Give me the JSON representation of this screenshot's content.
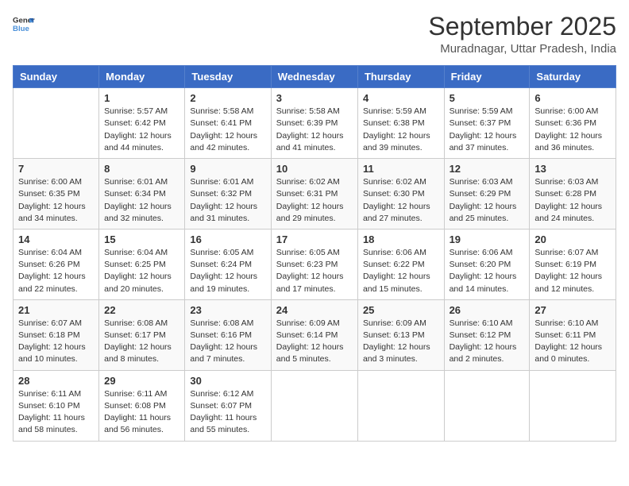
{
  "header": {
    "logo_general": "General",
    "logo_blue": "Blue",
    "month_year": "September 2025",
    "location": "Muradnagar, Uttar Pradesh, India"
  },
  "weekdays": [
    "Sunday",
    "Monday",
    "Tuesday",
    "Wednesday",
    "Thursday",
    "Friday",
    "Saturday"
  ],
  "weeks": [
    [
      {
        "day": "",
        "info": ""
      },
      {
        "day": "1",
        "info": "Sunrise: 5:57 AM\nSunset: 6:42 PM\nDaylight: 12 hours\nand 44 minutes."
      },
      {
        "day": "2",
        "info": "Sunrise: 5:58 AM\nSunset: 6:41 PM\nDaylight: 12 hours\nand 42 minutes."
      },
      {
        "day": "3",
        "info": "Sunrise: 5:58 AM\nSunset: 6:39 PM\nDaylight: 12 hours\nand 41 minutes."
      },
      {
        "day": "4",
        "info": "Sunrise: 5:59 AM\nSunset: 6:38 PM\nDaylight: 12 hours\nand 39 minutes."
      },
      {
        "day": "5",
        "info": "Sunrise: 5:59 AM\nSunset: 6:37 PM\nDaylight: 12 hours\nand 37 minutes."
      },
      {
        "day": "6",
        "info": "Sunrise: 6:00 AM\nSunset: 6:36 PM\nDaylight: 12 hours\nand 36 minutes."
      }
    ],
    [
      {
        "day": "7",
        "info": "Sunrise: 6:00 AM\nSunset: 6:35 PM\nDaylight: 12 hours\nand 34 minutes."
      },
      {
        "day": "8",
        "info": "Sunrise: 6:01 AM\nSunset: 6:34 PM\nDaylight: 12 hours\nand 32 minutes."
      },
      {
        "day": "9",
        "info": "Sunrise: 6:01 AM\nSunset: 6:32 PM\nDaylight: 12 hours\nand 31 minutes."
      },
      {
        "day": "10",
        "info": "Sunrise: 6:02 AM\nSunset: 6:31 PM\nDaylight: 12 hours\nand 29 minutes."
      },
      {
        "day": "11",
        "info": "Sunrise: 6:02 AM\nSunset: 6:30 PM\nDaylight: 12 hours\nand 27 minutes."
      },
      {
        "day": "12",
        "info": "Sunrise: 6:03 AM\nSunset: 6:29 PM\nDaylight: 12 hours\nand 25 minutes."
      },
      {
        "day": "13",
        "info": "Sunrise: 6:03 AM\nSunset: 6:28 PM\nDaylight: 12 hours\nand 24 minutes."
      }
    ],
    [
      {
        "day": "14",
        "info": "Sunrise: 6:04 AM\nSunset: 6:26 PM\nDaylight: 12 hours\nand 22 minutes."
      },
      {
        "day": "15",
        "info": "Sunrise: 6:04 AM\nSunset: 6:25 PM\nDaylight: 12 hours\nand 20 minutes."
      },
      {
        "day": "16",
        "info": "Sunrise: 6:05 AM\nSunset: 6:24 PM\nDaylight: 12 hours\nand 19 minutes."
      },
      {
        "day": "17",
        "info": "Sunrise: 6:05 AM\nSunset: 6:23 PM\nDaylight: 12 hours\nand 17 minutes."
      },
      {
        "day": "18",
        "info": "Sunrise: 6:06 AM\nSunset: 6:22 PM\nDaylight: 12 hours\nand 15 minutes."
      },
      {
        "day": "19",
        "info": "Sunrise: 6:06 AM\nSunset: 6:20 PM\nDaylight: 12 hours\nand 14 minutes."
      },
      {
        "day": "20",
        "info": "Sunrise: 6:07 AM\nSunset: 6:19 PM\nDaylight: 12 hours\nand 12 minutes."
      }
    ],
    [
      {
        "day": "21",
        "info": "Sunrise: 6:07 AM\nSunset: 6:18 PM\nDaylight: 12 hours\nand 10 minutes."
      },
      {
        "day": "22",
        "info": "Sunrise: 6:08 AM\nSunset: 6:17 PM\nDaylight: 12 hours\nand 8 minutes."
      },
      {
        "day": "23",
        "info": "Sunrise: 6:08 AM\nSunset: 6:16 PM\nDaylight: 12 hours\nand 7 minutes."
      },
      {
        "day": "24",
        "info": "Sunrise: 6:09 AM\nSunset: 6:14 PM\nDaylight: 12 hours\nand 5 minutes."
      },
      {
        "day": "25",
        "info": "Sunrise: 6:09 AM\nSunset: 6:13 PM\nDaylight: 12 hours\nand 3 minutes."
      },
      {
        "day": "26",
        "info": "Sunrise: 6:10 AM\nSunset: 6:12 PM\nDaylight: 12 hours\nand 2 minutes."
      },
      {
        "day": "27",
        "info": "Sunrise: 6:10 AM\nSunset: 6:11 PM\nDaylight: 12 hours\nand 0 minutes."
      }
    ],
    [
      {
        "day": "28",
        "info": "Sunrise: 6:11 AM\nSunset: 6:10 PM\nDaylight: 11 hours\nand 58 minutes."
      },
      {
        "day": "29",
        "info": "Sunrise: 6:11 AM\nSunset: 6:08 PM\nDaylight: 11 hours\nand 56 minutes."
      },
      {
        "day": "30",
        "info": "Sunrise: 6:12 AM\nSunset: 6:07 PM\nDaylight: 11 hours\nand 55 minutes."
      },
      {
        "day": "",
        "info": ""
      },
      {
        "day": "",
        "info": ""
      },
      {
        "day": "",
        "info": ""
      },
      {
        "day": "",
        "info": ""
      }
    ]
  ]
}
